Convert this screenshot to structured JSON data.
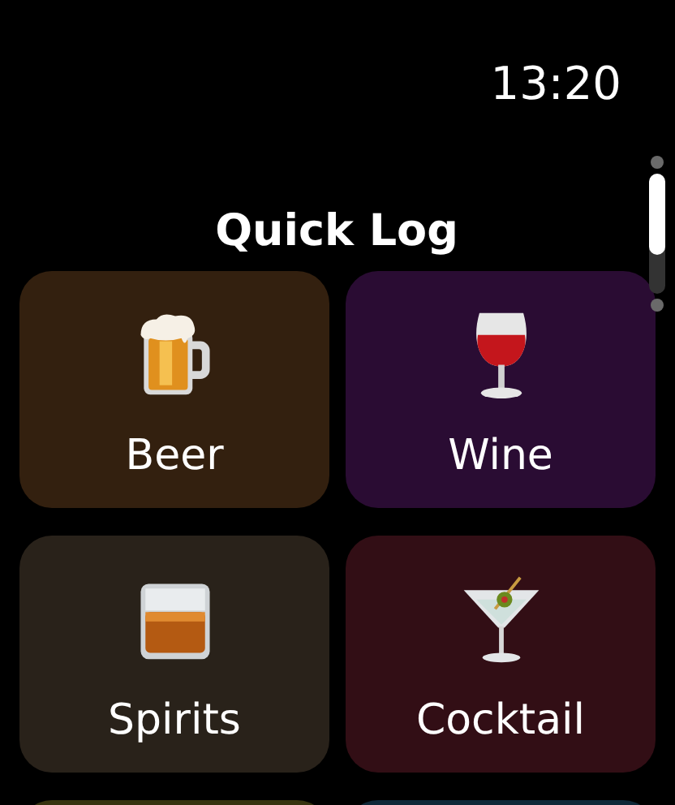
{
  "status_bar": {
    "time": "13:20"
  },
  "title": "Quick Log",
  "tiles": [
    {
      "kind": "beer",
      "label": "Beer",
      "color": "#33200f"
    },
    {
      "kind": "wine",
      "label": "Wine",
      "color": "#2a0c33"
    },
    {
      "kind": "spirits",
      "label": "Spirits",
      "color": "#29221a"
    },
    {
      "kind": "cocktail",
      "label": "Cocktail",
      "color": "#320e15"
    },
    {
      "kind": "partial",
      "color": "#37330f"
    },
    {
      "kind": "partial",
      "color": "#0f2838"
    }
  ]
}
